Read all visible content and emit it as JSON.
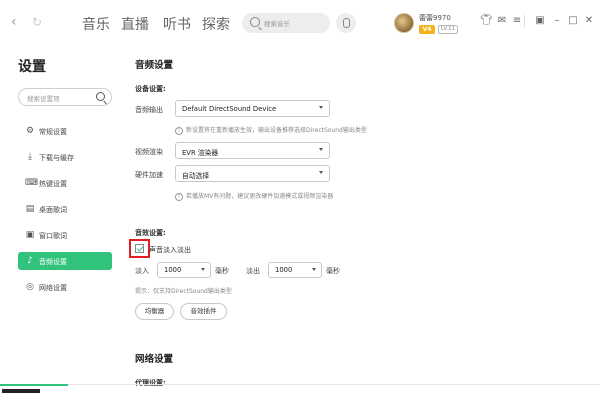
{
  "topbar": {
    "back_icon": "chevron-left-icon",
    "refresh_icon": "refresh-icon",
    "tabs": [
      "音乐",
      "直播",
      "听书",
      "探索"
    ],
    "search_placeholder": "搜索音乐",
    "username": "蕾蕾9970",
    "vip": "V4",
    "level": "LV.11"
  },
  "sidebar": {
    "title": "设置",
    "search_placeholder": "搜索设置项",
    "items": [
      {
        "label": "常规设置",
        "icon": "gear-icon",
        "glyph": "⚙"
      },
      {
        "label": "下载与缓存",
        "icon": "download-icon",
        "glyph": "⤓"
      },
      {
        "label": "热键设置",
        "icon": "keyboard-icon",
        "glyph": "⌨"
      },
      {
        "label": "桌面歌词",
        "icon": "desktop-lyrics-icon",
        "glyph": "▤"
      },
      {
        "label": "窗口歌词",
        "icon": "window-lyrics-icon",
        "glyph": "▣"
      },
      {
        "label": "音频设置",
        "icon": "audio-icon",
        "glyph": "♪",
        "active": true
      },
      {
        "label": "网络设置",
        "icon": "globe-icon",
        "glyph": "◎"
      }
    ]
  },
  "audio": {
    "section_title": "音频设置",
    "device_title": "设备设置:",
    "output_label": "音频输出",
    "output_value": "Default DirectSound Device",
    "output_hint": "新设置将在重新播放生效，输出设备推荐选择DirectSound输出类型",
    "render_label": "视频渲染",
    "render_value": "EVR 渲染器",
    "accel_label": "硬件加速",
    "accel_value": "自动选择",
    "accel_hint": "若播放MV有问题，建议更改硬件加速模式或视频渲染器",
    "effect_title": "音效设置:",
    "fade_label": "声音淡入淡出",
    "fade_checked": true,
    "fade_in_label": "淡入",
    "fade_in_value": "1000",
    "fade_in_unit": "毫秒",
    "fade_out_label": "淡出",
    "fade_out_value": "1000",
    "fade_out_unit": "毫秒",
    "effect_hint": "提示：仅支持DirectSound输出类型",
    "equalizer_button": "均衡器",
    "plugin_button": "音效插件"
  },
  "network": {
    "section_title": "网络设置",
    "proxy_title": "代理设置:"
  },
  "colors": {
    "accent": "#31c27c",
    "highlight": "#e02020"
  }
}
